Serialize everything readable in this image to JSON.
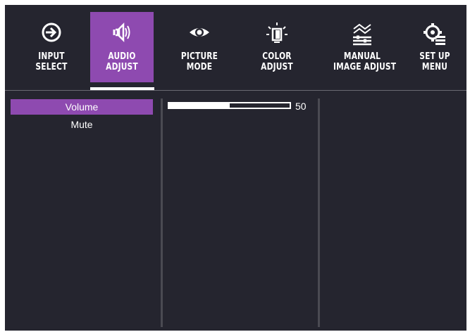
{
  "tabs": [
    {
      "line1": "INPUT",
      "line2": "SELECT",
      "icon": "input-select-icon",
      "active": false
    },
    {
      "line1": "AUDIO",
      "line2": "ADJUST",
      "icon": "speaker-icon",
      "active": true
    },
    {
      "line1": "PICTURE",
      "line2": "MODE",
      "icon": "eye-icon",
      "active": false
    },
    {
      "line1": "COLOR",
      "line2": "ADJUST",
      "icon": "color-bulb-icon",
      "active": false
    },
    {
      "line1": "MANUAL",
      "line2": "IMAGE ADJUST",
      "icon": "image-adjust-icon",
      "active": false
    },
    {
      "line1": "SET UP",
      "line2": "MENU",
      "icon": "gear-menu-icon",
      "active": false
    }
  ],
  "menu": {
    "items": [
      {
        "label": "Volume",
        "selected": true
      },
      {
        "label": "Mute",
        "selected": false
      }
    ]
  },
  "volume": {
    "value": "50",
    "level_percent": 50
  },
  "colors": {
    "background": "#25252f",
    "accent": "#8e4ab0",
    "text": "#ffffff"
  }
}
